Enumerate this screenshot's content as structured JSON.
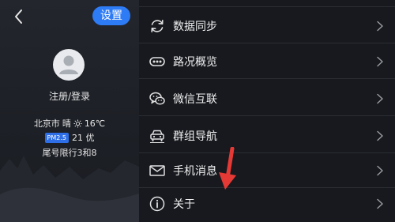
{
  "header": {
    "settings_label": "设置"
  },
  "profile": {
    "login_text": "注册/登录",
    "city": "北京市",
    "weather": "晴",
    "temperature": "16℃",
    "pm_label": "PM2.5",
    "aqi": "21 优",
    "traffic_limit": "尾号限行3和8"
  },
  "menu": {
    "items": [
      {
        "label": "数据同步",
        "icon": "sync-icon"
      },
      {
        "label": "路况概览",
        "icon": "traffic-icon"
      },
      {
        "label": "微信互联",
        "icon": "wechat-icon"
      },
      {
        "label": "群组导航",
        "icon": "car-icon"
      },
      {
        "label": "手机消息",
        "icon": "mail-icon"
      },
      {
        "label": "关于",
        "icon": "info-icon"
      }
    ]
  },
  "colors": {
    "accent": "#2e7bf6",
    "annotation_arrow": "#e53935"
  }
}
